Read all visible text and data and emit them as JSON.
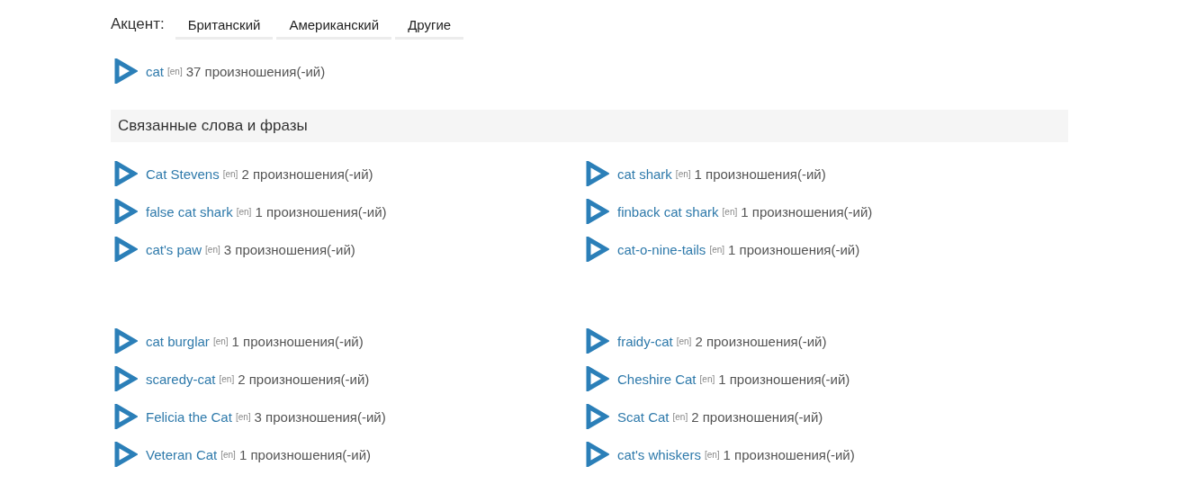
{
  "accent": {
    "label": "Акцент:",
    "tabs": [
      {
        "label": "Британский",
        "selected": false
      },
      {
        "label": "Американский",
        "selected": false
      },
      {
        "label": "Другие",
        "selected": false
      }
    ]
  },
  "main_word": {
    "word": "cat",
    "lang": "[en]",
    "count": "37 произношения(-ий)"
  },
  "related": {
    "title": "Связанные слова и фразы",
    "groups": [
      [
        {
          "word": "Cat Stevens",
          "lang": "[en]",
          "count": "2 произношения(-ий)"
        },
        {
          "word": "cat shark",
          "lang": "[en]",
          "count": "1 произношения(-ий)"
        },
        {
          "word": "false cat shark",
          "lang": "[en]",
          "count": "1 произношения(-ий)"
        },
        {
          "word": "finback cat shark",
          "lang": "[en]",
          "count": "1 произношения(-ий)"
        },
        {
          "word": "cat's paw",
          "lang": "[en]",
          "count": "3 произношения(-ий)"
        },
        {
          "word": "cat-o-nine-tails",
          "lang": "[en]",
          "count": "1 произношения(-ий)"
        }
      ],
      [
        {
          "word": "cat burglar",
          "lang": "[en]",
          "count": "1 произношения(-ий)"
        },
        {
          "word": "fraidy-cat",
          "lang": "[en]",
          "count": "2 произношения(-ий)"
        },
        {
          "word": "scaredy-cat",
          "lang": "[en]",
          "count": "2 произношения(-ий)"
        },
        {
          "word": "Cheshire Cat",
          "lang": "[en]",
          "count": "1 произношения(-ий)"
        },
        {
          "word": "Felicia the Cat",
          "lang": "[en]",
          "count": "3 произношения(-ий)"
        },
        {
          "word": "Scat Cat",
          "lang": "[en]",
          "count": "2 произношения(-ий)"
        },
        {
          "word": "Veteran Cat",
          "lang": "[en]",
          "count": "1 произношения(-ий)"
        },
        {
          "word": "cat's whiskers",
          "lang": "[en]",
          "count": "1 произношения(-ий)"
        }
      ]
    ]
  }
}
